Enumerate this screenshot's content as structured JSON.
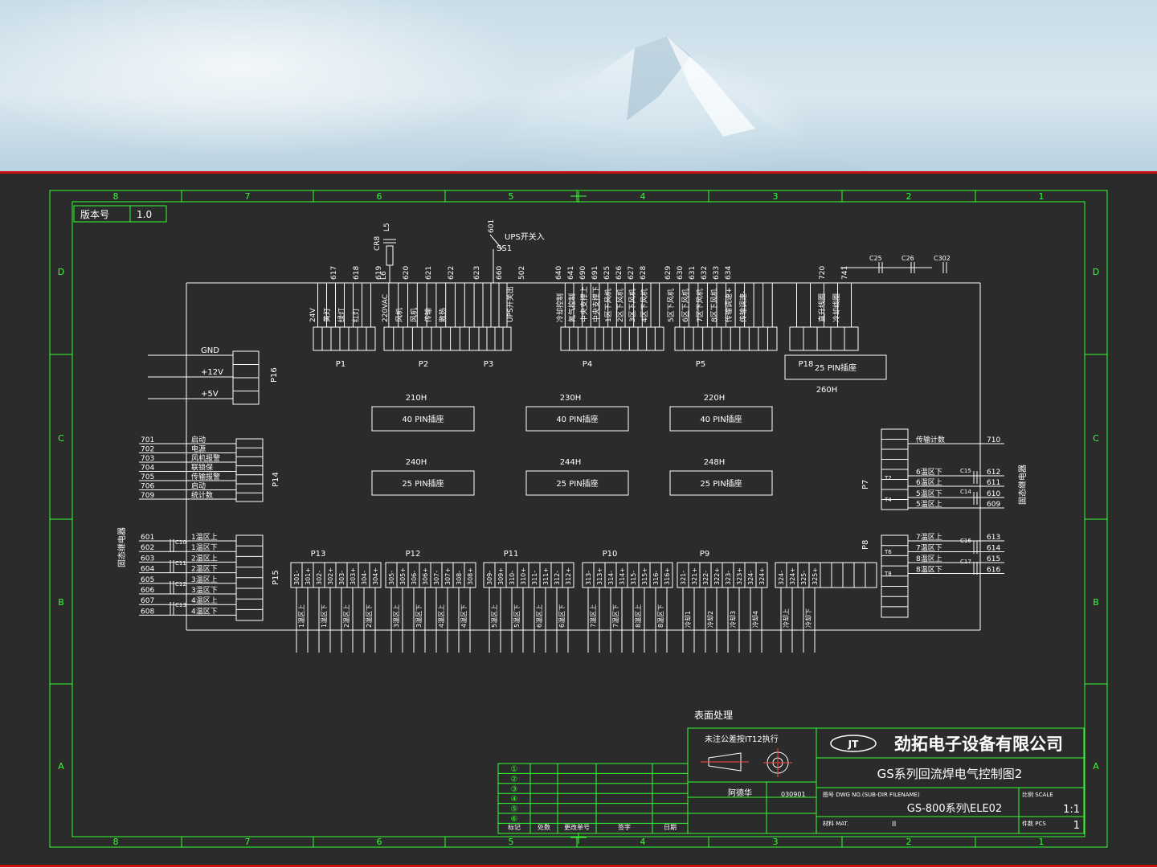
{
  "drawing": {
    "version_label": "版本号",
    "version_value": "1.0",
    "zone_cols": [
      "8",
      "7",
      "6",
      "5",
      "4",
      "3",
      "2",
      "1"
    ],
    "zone_rows": [
      "D",
      "C",
      "B",
      "A"
    ],
    "surface_label": "表面处理",
    "tolerance_note": "未注公差按IT12执行",
    "company": "劲拓电子设备有限公司",
    "logo": "JT",
    "title": "GS系列回流焊电气控制图2",
    "dwg_label": "图号 DWG NO.(SUB-DIR FILENAME)",
    "dwg_no": "GS-800系列\\ELE02",
    "scale_label": "比例 SCALE",
    "scale": "1:1",
    "material_label": "材料 MAT.",
    "material_value": "II",
    "pcs_label": "件数 PCS",
    "pcs": "1",
    "sheet_cell": "阿德华",
    "date_cell": "030901",
    "rev_headers": [
      "标记",
      "处数",
      "更改单号",
      "签字",
      "日期"
    ],
    "rev_marks": [
      "①",
      "②",
      "③",
      "④",
      "⑤",
      "⑥"
    ]
  },
  "connectors": {
    "p1": {
      "name": "P1",
      "pins": [
        "24V",
        "黄灯",
        "绿灯",
        "红灯"
      ],
      "wires": [
        "617",
        "618",
        "619"
      ]
    },
    "p2": {
      "name": "P2",
      "pins": [
        "220VAC",
        "风机",
        "风机",
        "传输",
        "散热"
      ],
      "wires": [
        "L6",
        "620",
        "621",
        "622"
      ]
    },
    "p3": {
      "name": "P3",
      "pins": [
        "UPS开关出"
      ],
      "wires": [
        "623",
        "660",
        "502"
      ]
    },
    "p4": {
      "name": "P4",
      "pins": [
        "冷却控制",
        "氮气控制",
        "中央支撑上",
        "中央支撑下",
        "1区下风机",
        "2区下风机",
        "3区下风机",
        "4区下风机"
      ],
      "wires": [
        "640",
        "641",
        "690",
        "691",
        "625",
        "626",
        "627",
        "628"
      ]
    },
    "p5": {
      "name": "P5",
      "pins": [
        "5区下风机",
        "6区下风机",
        "7区下风机",
        "8区下风机",
        "传输调速+",
        "传输调速-"
      ],
      "wires": [
        "629",
        "630",
        "631",
        "632",
        "633",
        "634"
      ]
    },
    "p18": {
      "name": "P18",
      "pins": [
        "直升线圈",
        "冷却线圈"
      ],
      "wires": [
        "720",
        "741"
      ]
    },
    "p16": {
      "name": "P16",
      "pins": [
        "GND",
        "+12V",
        "+5V"
      ]
    },
    "p14": {
      "name": "P14",
      "wires": [
        "701",
        "702",
        "703",
        "704",
        "705",
        "706",
        "709"
      ],
      "pins": [
        "启动",
        "电源",
        "风机报警",
        "联锁保",
        "传输报警",
        "启动",
        "统计数"
      ]
    },
    "p15": {
      "name": "P15",
      "wires": [
        "601",
        "602",
        "603",
        "604",
        "605",
        "606",
        "607",
        "608"
      ],
      "pins": [
        "1温区上",
        "1温区下",
        "2温区上",
        "2温区下",
        "3温区上",
        "3温区下",
        "4温区上",
        "4温区下"
      ],
      "caps": [
        "C10",
        "C11",
        "C12",
        "C13"
      ]
    },
    "p7": {
      "name": "P7",
      "wires": [
        "710",
        "612",
        "611",
        "610",
        "609"
      ],
      "pins": [
        "传输计数",
        "6温区下",
        "6温区上",
        "5温区下",
        "5温区上"
      ],
      "caps": [
        "C15",
        "C14"
      ],
      "tags": [
        "T2",
        "T4"
      ]
    },
    "p8": {
      "name": "P8",
      "wires": [
        "613",
        "614",
        "615",
        "616"
      ],
      "pins": [
        "7温区上",
        "7温区下",
        "8温区上",
        "8温区下"
      ],
      "caps": [
        "C16",
        "C17"
      ],
      "tags": [
        "T6",
        "T8"
      ]
    },
    "ups": {
      "label": "UPS开关入",
      "wire": "601",
      "switch": "SS1"
    },
    "cr8": {
      "label": "CR8",
      "wire": "L5"
    },
    "top_caps": [
      "C25",
      "C26",
      "C302"
    ],
    "bottom_groups": [
      {
        "name": "P13",
        "pins": [
          "301-",
          "301+",
          "302-",
          "302+",
          "303-",
          "303+",
          "304-",
          "304+"
        ],
        "labels": [
          "1温区上",
          "1温区下",
          "2温区上",
          "2温区下"
        ]
      },
      {
        "name": "P12",
        "pins": [
          "305-",
          "305+",
          "306-",
          "306+",
          "307-",
          "307+",
          "308-",
          "308+"
        ],
        "labels": [
          "3温区上",
          "3温区下",
          "4温区上",
          "4温区下"
        ]
      },
      {
        "name": "P11",
        "pins": [
          "309-",
          "309+",
          "310-",
          "310+",
          "311-",
          "311+",
          "312-",
          "312+"
        ],
        "labels": [
          "5温区上",
          "5温区下",
          "6温区上",
          "6温区下"
        ]
      },
      {
        "name": "P10",
        "pins": [
          "313-",
          "313+",
          "314-",
          "314+",
          "315-",
          "315+",
          "316-",
          "316+"
        ],
        "labels": [
          "7温区上",
          "7温区下",
          "8温区上",
          "8温区下"
        ]
      },
      {
        "name": "P9",
        "pins": [
          "321-",
          "321+",
          "322-",
          "322+",
          "323-",
          "323+",
          "324-",
          "324+"
        ],
        "labels": [
          "冷却1",
          "冷却2",
          "冷却3",
          "冷却4"
        ]
      },
      {
        "name": "",
        "pins": [
          "324-",
          "324+",
          "325-",
          "325+"
        ],
        "labels": [
          "冷却上",
          "冷却下"
        ]
      }
    ],
    "side_label": "固态继电器"
  },
  "sockets": [
    {
      "id": "210H",
      "label": "40 PIN插座"
    },
    {
      "id": "230H",
      "label": "40 PIN插座"
    },
    {
      "id": "220H",
      "label": "40 PIN插座"
    },
    {
      "id": "240H",
      "label": "25 PIN插座"
    },
    {
      "id": "244H",
      "label": "25 PIN插座"
    },
    {
      "id": "248H",
      "label": "25 PIN插座"
    },
    {
      "id": "260H",
      "label": "25 PIN插座"
    }
  ],
  "colors": {
    "frame": "#33ff33",
    "ink": "#ffffff",
    "background": "#2b2b2b",
    "accent": "#cc1111"
  }
}
